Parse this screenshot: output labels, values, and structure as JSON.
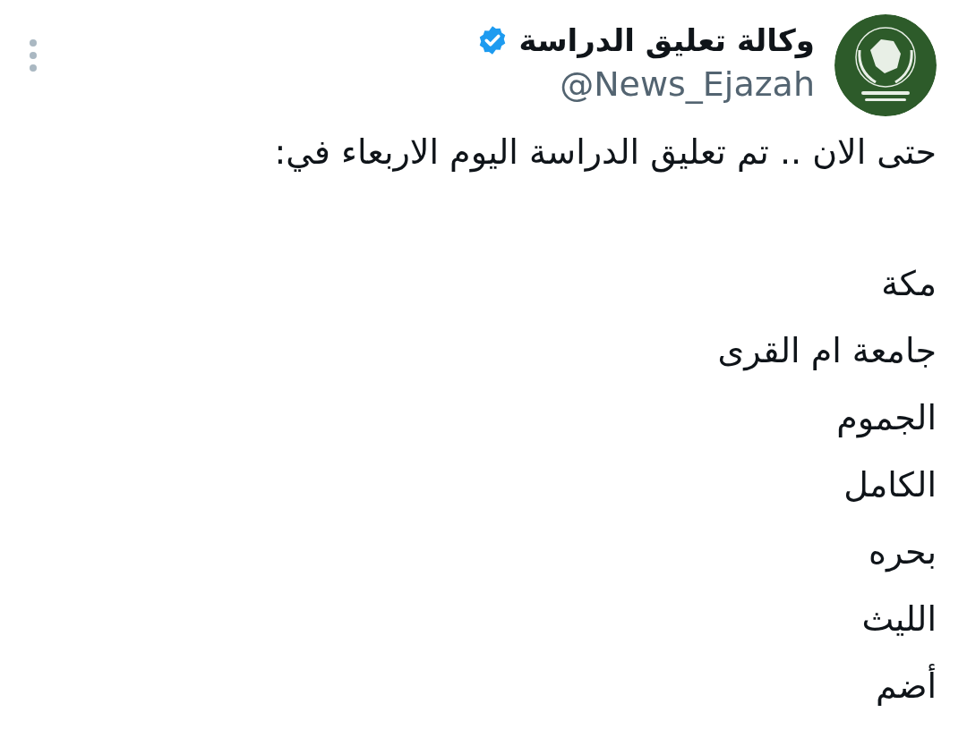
{
  "tweet": {
    "author": {
      "name": "وكالة تعليق الدراسة",
      "verified": true,
      "handle": "@News_Ejazah"
    },
    "intro": "حتى الان .. تم تعليق الدراسة اليوم الاربعاء في:",
    "places": [
      "مكة",
      "جامعة ام القرى",
      "الجموم",
      "الكامل",
      "بحره",
      "الليث",
      "أضم"
    ]
  }
}
